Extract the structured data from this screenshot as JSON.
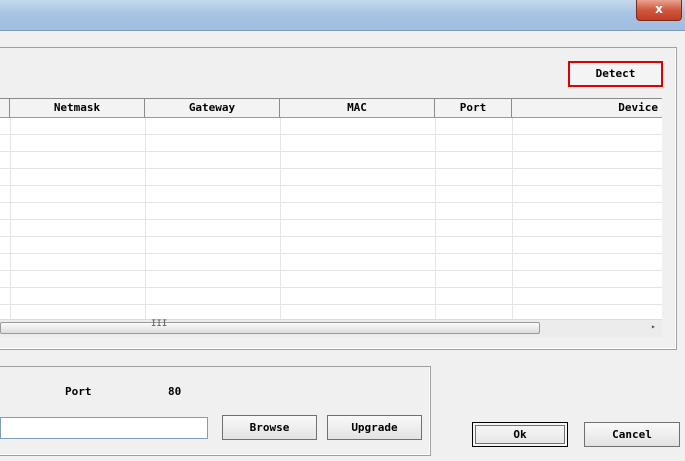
{
  "window": {
    "title": "",
    "close_glyph": "x"
  },
  "detect_label": "Detect",
  "table": {
    "columns": [
      "Netmask",
      "Gateway",
      "MAC",
      "Port",
      "Device"
    ],
    "rows": []
  },
  "scrollbar": {
    "grip_glyph": "III",
    "right_arrow_glyph": "▸"
  },
  "upgrade": {
    "port_label": "Port",
    "port_value": "80",
    "file_value": "",
    "browse_label": "Browse",
    "upgrade_label": "Upgrade"
  },
  "dialog_buttons": {
    "ok_label": "Ok",
    "cancel_label": "Cancel"
  }
}
